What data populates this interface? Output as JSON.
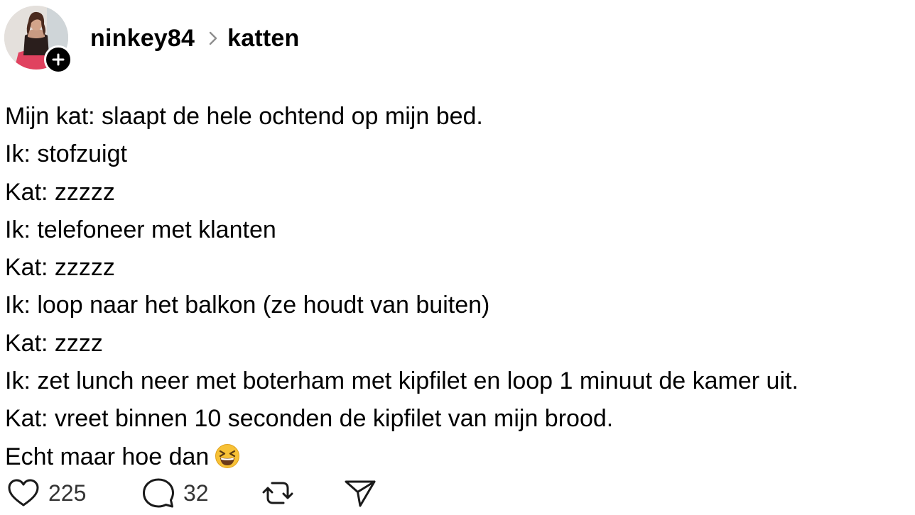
{
  "header": {
    "username": "ninkey84",
    "topic": "katten",
    "avatar_icon": "profile-photo",
    "follow_icon": "plus-icon",
    "separator_icon": "chevron-right-icon"
  },
  "post": {
    "lines": [
      "Mijn kat: slaapt de hele ochtend op mijn bed.",
      "Ik: stofzuigt",
      "Kat: zzzzz",
      "Ik: telefoneer met klanten",
      "Kat: zzzzz",
      "Ik: loop naar het balkon (ze houdt van buiten)",
      "Kat: zzzz",
      "Ik: zet lunch neer met boterham met kipfilet en loop 1 minuut de kamer uit.",
      "Kat: vreet binnen 10 seconden de kipfilet van mijn brood.",
      "Echt maar hoe dan"
    ],
    "emoji": "grinning-squinting-face"
  },
  "actions": {
    "like_count": "225",
    "reply_count": "32",
    "like_icon": "heart-icon",
    "reply_icon": "comment-bubble-icon",
    "repost_icon": "repost-icon",
    "share_icon": "send-icon"
  },
  "colors": {
    "text": "#000000",
    "muted": "#333333",
    "background": "#ffffff",
    "emoji": "#f7c136"
  }
}
